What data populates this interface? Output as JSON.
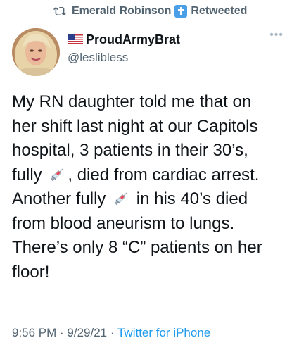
{
  "retweet": {
    "icon": "retweet-icon",
    "name": "Emerald Robinson",
    "badge_icon": "cross-icon",
    "label": "Retweeted"
  },
  "author": {
    "flag_icon": "us-flag-icon",
    "display_name": "ProudArmyBrat",
    "handle": "@leslibless"
  },
  "more_icon": "more-icon",
  "tweet": {
    "line1": "My RN daughter told me that on",
    "line2": "her shift last night at our Capitols",
    "line3": "hospital, 3 patients in their 30’s,",
    "line4_a": "fully",
    "line4_b": ", died from cardiac arrest.",
    "line5_a": "Another fully",
    "line5_b": " in his 40’s died",
    "line6": "from blood aneurism to lungs.",
    "line7": "There’s only 8 “C” patients on her",
    "line8": "floor!",
    "emoji_icon": "syringe-icon"
  },
  "meta": {
    "time": "9:56 PM",
    "sep1": " · ",
    "date": "9/29/21",
    "sep2": " · ",
    "source": "Twitter for iPhone"
  },
  "colors": {
    "text": "#0f1419",
    "secondary": "#536471",
    "link": "#1d9bf0",
    "badge": "#4a9fe6"
  }
}
